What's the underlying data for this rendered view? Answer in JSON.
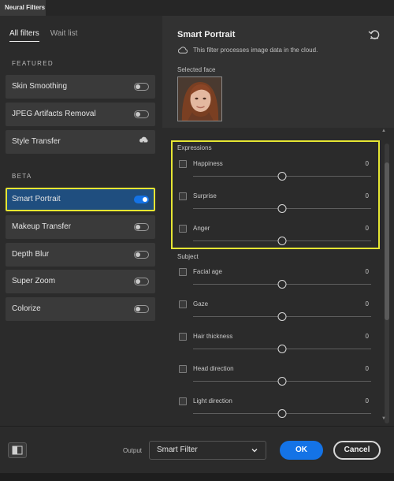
{
  "window": {
    "panel_tab": "Neural Filters"
  },
  "left_panel": {
    "tabs": [
      {
        "label": "All filters",
        "active": true
      },
      {
        "label": "Wait list",
        "active": false
      }
    ],
    "featured_label": "FEATURED",
    "beta_label": "BETA",
    "featured": [
      {
        "label": "Skin Smoothing",
        "state": "off"
      },
      {
        "label": "JPEG Artifacts Removal",
        "state": "off"
      },
      {
        "label": "Style Transfer",
        "state": "cloud-download"
      }
    ],
    "beta": [
      {
        "label": "Smart Portrait",
        "state": "on",
        "selected": true
      },
      {
        "label": "Makeup Transfer",
        "state": "off"
      },
      {
        "label": "Depth Blur",
        "state": "off"
      },
      {
        "label": "Super Zoom",
        "state": "off"
      },
      {
        "label": "Colorize",
        "state": "off"
      }
    ]
  },
  "right_panel": {
    "title": "Smart Portrait",
    "cloud_note": "This filter processes image data in the cloud.",
    "selected_face_label": "Selected face",
    "expressions_label": "Expressions",
    "expressions": [
      {
        "label": "Happiness",
        "value": "0",
        "level": 0.5
      },
      {
        "label": "Surprise",
        "value": "0",
        "level": 0.5
      },
      {
        "label": "Anger",
        "value": "0",
        "level": 0.5
      }
    ],
    "subject_label": "Subject",
    "subject": [
      {
        "label": "Facial age",
        "value": "0",
        "level": 0.5
      },
      {
        "label": "Gaze",
        "value": "0",
        "level": 0.5
      },
      {
        "label": "Hair thickness",
        "value": "0",
        "level": 0.5
      },
      {
        "label": "Head direction",
        "value": "0",
        "level": 0.5
      },
      {
        "label": "Light direction",
        "value": "0",
        "level": 0.5
      }
    ]
  },
  "bottom_bar": {
    "output_label": "Output",
    "output_value": "Smart Filter",
    "ok_label": "OK",
    "cancel_label": "Cancel"
  },
  "colors": {
    "accent": "#1473e6",
    "highlight": "#e6e633",
    "selected_bg": "#1f4e7f"
  }
}
